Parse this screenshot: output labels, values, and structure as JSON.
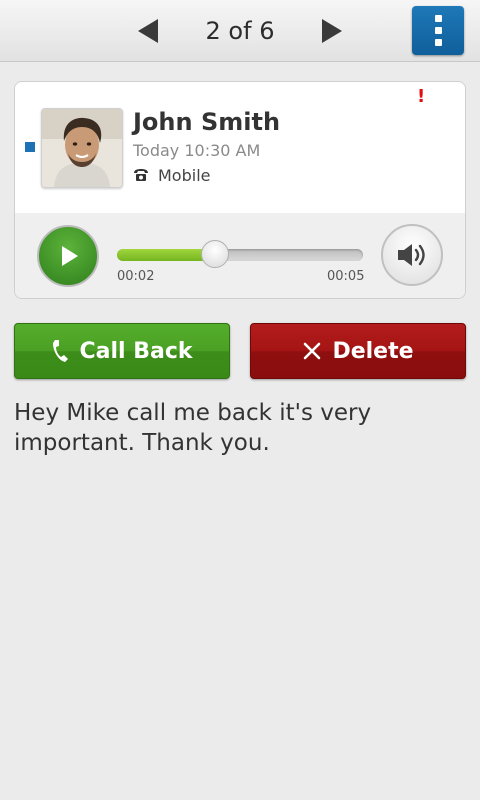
{
  "topbar": {
    "pager_text": "2 of 6",
    "prev_icon": "chevron-left-icon",
    "next_icon": "chevron-right-icon",
    "menu_icon": "vertical-dots-icon",
    "menu_color": "#1a6fae"
  },
  "voicemail": {
    "unread": true,
    "urgent_mark": "!",
    "caller_name": "John Smith",
    "timestamp": "Today 10:30 AM",
    "phone_type": "Mobile",
    "phone_icon": "telephone-icon"
  },
  "player": {
    "elapsed": "00:02",
    "total": "00:05",
    "progress_fraction": 0.4,
    "play_icon": "play-icon",
    "speaker_icon": "speaker-icon",
    "progress_color": "#8cc63f"
  },
  "actions": {
    "call_back_label": "Call Back",
    "delete_label": "Delete",
    "call_back_color": "#4aa023",
    "delete_color": "#a51414"
  },
  "transcript": "Hey Mike call me back it's very important. Thank you."
}
